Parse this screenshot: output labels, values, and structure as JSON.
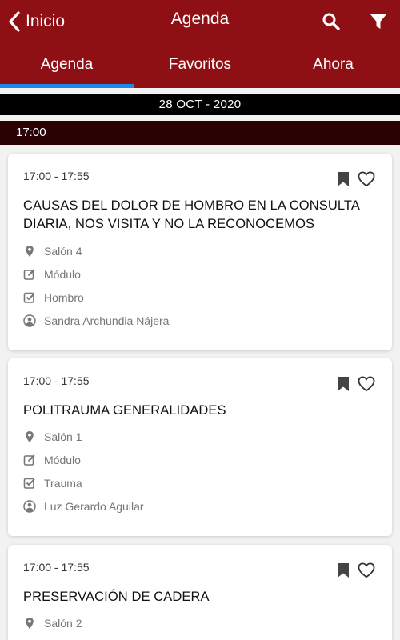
{
  "header": {
    "back_label": "Inicio",
    "title": "Agenda"
  },
  "tabs": [
    {
      "label": "Agenda",
      "active": true
    },
    {
      "label": "Favoritos",
      "active": false
    },
    {
      "label": "Ahora",
      "active": false
    }
  ],
  "date_label": "28 OCT - 2020",
  "time_group": "17:00",
  "sessions": [
    {
      "time": "17:00 - 17:55",
      "title": "CAUSAS DEL DOLOR DE HOMBRO EN LA CONSULTA DIARIA, NOS VISITA Y NO LA RECONOCEMOS",
      "room": "Salón 4",
      "type": "Módulo",
      "topic": "Hombro",
      "speaker": "Sandra Archundia Nájera"
    },
    {
      "time": "17:00 - 17:55",
      "title": "POLITRAUMA GENERALIDADES",
      "room": "Salón 1",
      "type": "Módulo",
      "topic": "Trauma",
      "speaker": "Luz Gerardo Aguilar"
    },
    {
      "time": "17:00 - 17:55",
      "title": "PRESERVACIÓN DE CADERA",
      "room": "Salón 2"
    }
  ],
  "icons": {
    "back": "chevron-left-icon",
    "search": "search-icon",
    "filter": "filter-icon",
    "bookmark": "bookmark-icon",
    "favorite": "heart-icon",
    "room": "map-pin-icon",
    "type": "edit-icon",
    "topic": "checkbox-icon",
    "speaker": "user-circle-icon"
  },
  "colors": {
    "header": "#8e1015",
    "tab_indicator": "#1e88e5",
    "date_bar": "#000000",
    "time_bar": "#2a0204"
  }
}
